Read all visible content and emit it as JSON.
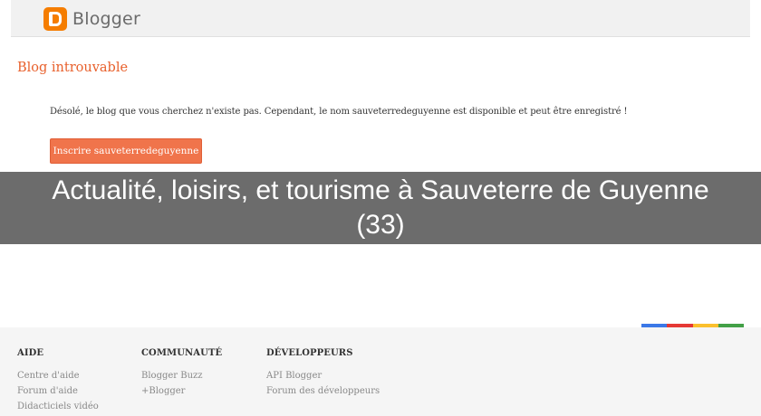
{
  "header": {
    "logo_text": "Blogger"
  },
  "main": {
    "title": "Blog introuvable",
    "message": "Désolé, le blog que vous cherchez n'existe pas. Cependant, le nom sauveterredeguyenne est disponible et peut être enregistré !",
    "register_button": "Inscrire sauveterredeguyenne"
  },
  "overlay": {
    "text": "Actualité, loisirs, et tourisme à Sauveterre de Guyenne (33)"
  },
  "footer": {
    "color_bar": [
      "#3b78e7",
      "#e53935",
      "#fbc02d",
      "#43a047"
    ],
    "columns": [
      {
        "heading": "AIDE",
        "links": [
          "Centre d'aide",
          "Forum d'aide",
          "Didacticiels vidéo"
        ]
      },
      {
        "heading": "COMMUNAUTÉ",
        "links": [
          "Blogger Buzz",
          "+Blogger"
        ]
      },
      {
        "heading": "DÉVELOPPEURS",
        "links": [
          "API Blogger",
          "Forum des développeurs"
        ]
      }
    ]
  },
  "colors": {
    "brand_orange": "#f57d00",
    "title_orange": "#e8602c",
    "button_orange": "#f0744b"
  }
}
